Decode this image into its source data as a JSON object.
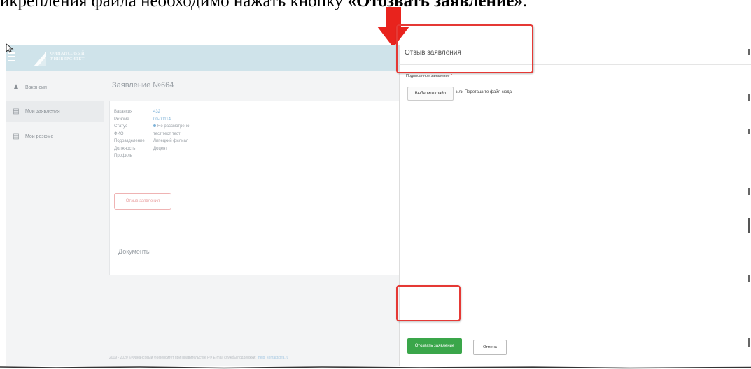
{
  "document": {
    "line_text": "икрепления файла необходимо нажать кнопку ",
    "line_bold": "«Отозвать заявление»",
    "line_tail": "."
  },
  "colors": {
    "header_bg": "#cfe3ea",
    "accent_red": "#e53935",
    "submit_green": "#3aa64a",
    "link_blue": "#7fb3d8"
  },
  "app": {
    "logo_text": "ФИНАНСОВЫЙ УНИВЕРСИТЕТ",
    "sidebar": {
      "items": [
        {
          "label": "Вакансии",
          "icon": "people-icon"
        },
        {
          "label": "Мои заявления",
          "icon": "document-icon"
        },
        {
          "label": "Мои резюме",
          "icon": "document-icon"
        }
      ]
    },
    "page_title": "Заявление №664",
    "details": [
      {
        "key": "Вакансия",
        "value": "432",
        "link": true
      },
      {
        "key": "Резюме",
        "value": "00-00114",
        "link": true
      },
      {
        "key": "Статус",
        "value": "Не рассмотрено",
        "status_dot": true
      },
      {
        "key": "ФИО",
        "value": "тест тест тест"
      },
      {
        "key": "Подразделение",
        "value": "Липецкий филиал"
      },
      {
        "key": "Должность",
        "value": "Доцент"
      },
      {
        "key": "Профиль",
        "value": ""
      }
    ],
    "withdraw_button": "Отзыв заявления",
    "documents_title": "Документы",
    "footer_text": "2019 - 2020 © Финансовый университет при Правительстве РФ     E-mail службы поддержки:",
    "footer_mail": "help_kontakt@fa.ru"
  },
  "panel": {
    "title": "Отзыв заявления",
    "field_label": "Подписанное заявление",
    "required_mark": "*",
    "file_button": "Выберите файл",
    "drag_text": "или Перетащите файл сюда",
    "submit_button": "Отозвать заявление",
    "cancel_button": "Отмена"
  }
}
